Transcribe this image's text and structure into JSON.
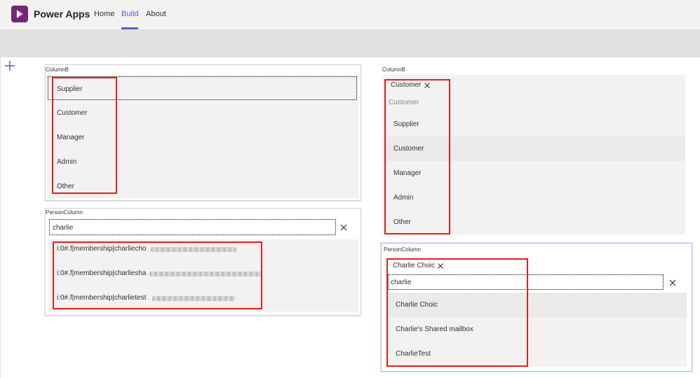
{
  "app": {
    "name": "Power Apps",
    "nav": [
      {
        "label": "Home",
        "active": false
      },
      {
        "label": "Build",
        "active": true
      },
      {
        "label": "About",
        "active": false
      }
    ],
    "brand_color": "#742774",
    "accent_color": "#5b5fc7"
  },
  "left": {
    "columnb": {
      "label": "ColumnB",
      "options": [
        "Supplier",
        "Customer",
        "Manager",
        "Admin",
        "Other"
      ]
    },
    "person": {
      "label": "PersonColumn",
      "search_value": "charlie",
      "results": [
        "i:0#.f|membership|charliecho",
        "i:0#.f|membership|charliesha",
        "i:0#.f|membership|charlietest"
      ]
    }
  },
  "right": {
    "columnb": {
      "label": "ColumnB",
      "selected_chip": "Customer",
      "placeholder": "Customer",
      "options": [
        "Supplier",
        "Customer",
        "Manager",
        "Admin",
        "Other"
      ],
      "highlighted": "Customer"
    },
    "person": {
      "label": "PersonColumn",
      "selected_chip": "Charlie Choic",
      "search_value": "charlie",
      "results": [
        "Charlie Choic",
        "Charlie's Shared mailbox",
        "CharlieTest"
      ],
      "highlighted": "Charlie Choic"
    }
  },
  "annotation_color": "#e02020"
}
